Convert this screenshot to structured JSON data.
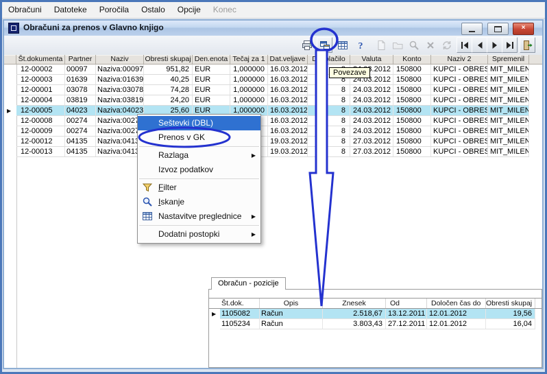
{
  "colors": {
    "annotation_blue": "#2432cf",
    "selection_cyan": "#b3e4f3",
    "menu_highlight_blue": "#2f71d1",
    "tooltip_yellow": "#ffffe1",
    "titlebar_blue": "#b9d0ea",
    "close_button_red": "#c74634"
  },
  "menu_bar": {
    "items": [
      {
        "label": "Obračuni"
      },
      {
        "label": "Datoteke"
      },
      {
        "label": "Poročila"
      },
      {
        "label": "Ostalo"
      },
      {
        "label": "Opcije"
      },
      {
        "label": "Konec",
        "disabled": true
      }
    ]
  },
  "window": {
    "title": "Obračuni za prenos v Glavno knjigo"
  },
  "toolbar": {
    "tooltip": "Povezave",
    "buttons": [
      {
        "icon": "print-icon"
      },
      {
        "icon": "links-icon",
        "annotated": true
      },
      {
        "icon": "table-icon"
      },
      {
        "icon": "help-icon"
      },
      {
        "icon": "doc-icon",
        "disabled": true
      },
      {
        "icon": "folder-icon",
        "disabled": true
      },
      {
        "icon": "search-icon",
        "disabled": true
      },
      {
        "icon": "delete-icon",
        "disabled": true
      },
      {
        "icon": "refresh-icon",
        "disabled": true
      },
      {
        "icon": "nav-first-icon"
      },
      {
        "icon": "nav-prev-icon"
      },
      {
        "icon": "nav-next-icon"
      },
      {
        "icon": "nav-last-icon"
      },
      {
        "icon": "exit-icon"
      }
    ]
  },
  "grid": {
    "columns": [
      "Št.dokumenta",
      "Partner",
      "Naziv",
      "Obresti skupaj",
      "Den.enota",
      "Tečaj za 1",
      "Dat.veljave",
      "Dni plačilo",
      "Valuta",
      "Konto",
      "Naziv 2",
      "Spremenil"
    ],
    "selected_index": 4,
    "rows": [
      [
        "12-00002",
        "00097",
        "Naziva:00097",
        "951,82",
        "EUR",
        "1,000000",
        "16.03.2012",
        "8",
        "24.03.2012",
        "150800",
        "KUPCI - OBRESTI",
        "MIT_MILEN"
      ],
      [
        "12-00003",
        "01639",
        "Naziva:01639",
        "40,25",
        "EUR",
        "1,000000",
        "16.03.2012",
        "8",
        "24.03.2012",
        "150800",
        "KUPCI - OBRESTI",
        "MIT_MILEN"
      ],
      [
        "12-00001",
        "03078",
        "Naziva:03078",
        "74,28",
        "EUR",
        "1,000000",
        "16.03.2012",
        "8",
        "24.03.2012",
        "150800",
        "KUPCI - OBRESTI",
        "MIT_MILEN"
      ],
      [
        "12-00004",
        "03819",
        "Naziva:03819",
        "24,20",
        "EUR",
        "1,000000",
        "16.03.2012",
        "8",
        "24.03.2012",
        "150800",
        "KUPCI - OBRESTI",
        "MIT_MILEN"
      ],
      [
        "12-00005",
        "04023",
        "Naziva:04023",
        "25,60",
        "EUR",
        "1,000000",
        "16.03.2012",
        "8",
        "24.03.2012",
        "150800",
        "KUPCI - OBRESTI",
        "MIT_MILEN"
      ],
      [
        "12-00008",
        "00274",
        "Naziva:00274",
        "",
        "",
        "",
        "16.03.2012",
        "8",
        "24.03.2012",
        "150800",
        "KUPCI - OBRESTI",
        "MIT_MILEN"
      ],
      [
        "12-00009",
        "00274",
        "Naziva:00274",
        "",
        "",
        "",
        "16.03.2012",
        "8",
        "24.03.2012",
        "150800",
        "KUPCI - OBRESTI",
        "MIT_MILEN"
      ],
      [
        "12-00012",
        "04135",
        "Naziva:04135",
        "",
        "",
        "",
        "19.03.2012",
        "8",
        "27.03.2012",
        "150800",
        "KUPCI - OBRESTI",
        "MIT_MILEN"
      ],
      [
        "12-00013",
        "04135",
        "Naziva:04135",
        "",
        "",
        "",
        "19.03.2012",
        "8",
        "27.03.2012",
        "150800",
        "KUPCI - OBRESTI",
        "MIT_MILEN"
      ]
    ]
  },
  "context_menu": {
    "items": [
      {
        "label": "Seštevki (DBL)",
        "highlighted": true
      },
      {
        "label": "Prenos v GK",
        "annotated": true
      },
      {
        "separator": true
      },
      {
        "label": "Razlaga",
        "submenu": true
      },
      {
        "label": "Izvoz podatkov"
      },
      {
        "separator": true
      },
      {
        "label": "Filter",
        "icon": "filter-icon",
        "accel": true
      },
      {
        "label": "Iskanje",
        "icon": "search-icon",
        "accel": true
      },
      {
        "label": "Nastavitve preglednice",
        "icon": "grid-icon",
        "submenu": true
      },
      {
        "separator": true
      },
      {
        "label": "Dodatni postopki",
        "submenu": true
      }
    ]
  },
  "positions_panel": {
    "tab_label": "Obračun - pozicije",
    "columns": [
      "Št.dok.",
      "Opis",
      "Znesek",
      "Od",
      "Določen čas do",
      "Obresti skupaj"
    ],
    "selected_index": 0,
    "rows": [
      [
        "1105082",
        "Račun",
        "2.518,67",
        "13.12.2011",
        "12.01.2012",
        "19,56"
      ],
      [
        "1105234",
        "Račun",
        "3.803,43",
        "27.12.2011",
        "12.01.2012",
        "16,04"
      ]
    ]
  }
}
